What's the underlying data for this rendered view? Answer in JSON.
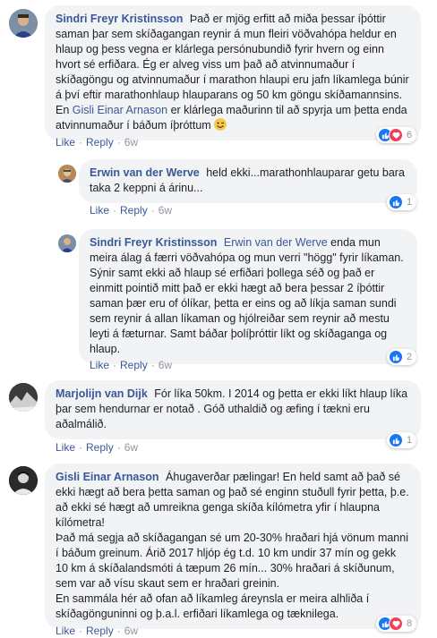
{
  "comments": [
    {
      "author": "Sindri Freyr Kristinsson",
      "text": "Það er mjög erfitt að miða þessar íþóttir saman þar sem skíðagangan reynir á mun fleiri vöðvahópa heldur en hlaup og þess vegna er klárlega persónubundið fyrir hvern og einn hvort sé erfiðara. Ég er alveg viss um það að atvinnumaður í skíðagöngu og atvinnumaður í marathon hlaupi eru jafn líkamlega búnir á því eftir marathonhlaup hlauparans og 50 km göngu skíðamannsins. En",
      "mention": "Gisli Einar Arnason",
      "text_after": "er klárlega maðurinn til að spyrja um þetta enda atvinnumaður í báðum íþróttum",
      "emoji": "wink-emoji",
      "like": "Like",
      "reply": "Reply",
      "time": "6w",
      "reactions": 6
    },
    {
      "author": "Erwin van der Werve",
      "text": "held ekki...marathonhlauparar getu bara taka 2 keppni á árinu...",
      "like": "Like",
      "reply": "Reply",
      "time": "6w",
      "reactions": 1
    },
    {
      "author": "Sindri Freyr Kristinsson",
      "mention": "Erwin van der Werve",
      "text": "enda mun meira álag á færri vöðvahópa og mun verri \"högg\" fyrir líkaman. Sýnir samt ekki að hlaup sé erfiðari þollega séð og það er einmitt pointið mitt það er ekki hægt að bera þessar 2 íþóttir saman þær eru of ólíkar, þetta er eins og að líkja saman sundi sem reynir á allan líkaman og hjólreiðar sem reynir að mestu leyti á fæturnar. Samt báðar þolíþróttir líkt og skíðaganga og hlaup.",
      "like": "Like",
      "reply": "Reply",
      "time": "6w",
      "reactions": 2
    },
    {
      "author": "Marjolijn van Dijk",
      "text": "Fór líka 50km. I 2014 og þetta er ekki líkt hlaup líka þar sem hendurnar er notað . Góð uthaldið og æfing í tækni eru aðalmálið.",
      "like": "Like",
      "reply": "Reply",
      "time": "6w",
      "reactions": 1
    },
    {
      "author": "Gisli Einar Arnason",
      "text": "Áhugaverðar pælingar! En held samt að það sé ekki hægt að bera þetta saman og það sé enginn stuðull fyrir þetta, þ.e. að ekki sé hægt að umreikna genga skíða kílómetra yfir í hlaupna kílómetra!",
      "text2": "Það má segja að skíðagangan sé um 20-30% hraðari hjá vönum manni í báðum greinum. Árið 2017 hljóp ég t.d. 10 km undir 37 mín og gekk 10 km á skíðalandsmóti á tæpum 26 mín... 30% hraðari á skíðunum, sem var að vísu skaut sem er hraðari greinin.",
      "text3": "En sammála hér að ofan að líkamleg áreynsla er meira alhliða í skíðagönguninni og þ.a.l. erfiðari líkamlega og tæknilega.",
      "like": "Like",
      "reply": "Reply",
      "time": "6w",
      "reactions": 8
    }
  ],
  "colors": {
    "link": "#385898",
    "bubble": "#f2f3f5",
    "like_blue": "#1877f2",
    "love_red": "#f33e58",
    "meta_gray": "#90949c"
  }
}
